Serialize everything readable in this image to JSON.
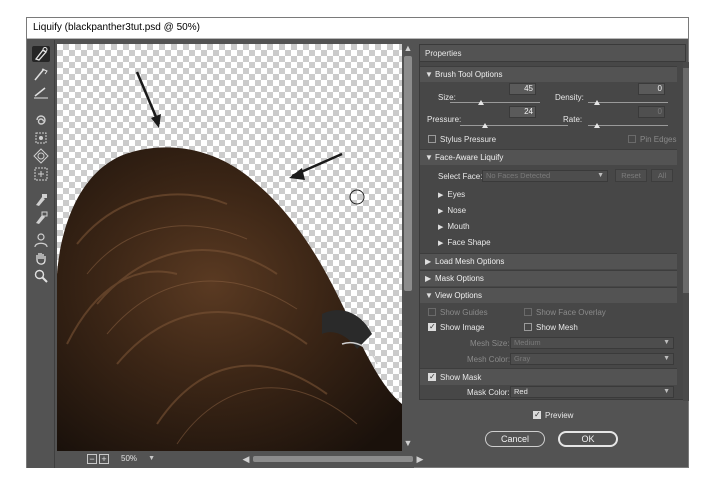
{
  "window": {
    "title": "Liquify (blackpanther3tut.psd @ 50%)"
  },
  "toolbar": {
    "tools": [
      {
        "name": "forward-warp-tool-icon",
        "active": true
      },
      {
        "name": "reconstruct-tool-icon"
      },
      {
        "name": "smooth-tool-icon"
      },
      {
        "name": "twirl-clockwise-tool-icon"
      },
      {
        "name": "pucker-tool-icon"
      },
      {
        "name": "bloat-tool-icon"
      },
      {
        "name": "push-left-tool-icon"
      },
      {
        "name": "freeze-mask-tool-icon"
      },
      {
        "name": "thaw-mask-tool-icon"
      },
      {
        "name": "face-tool-icon"
      },
      {
        "name": "hand-tool-icon"
      },
      {
        "name": "zoom-tool-icon"
      }
    ]
  },
  "status": {
    "zoom_minus": "−",
    "zoom_plus": "+",
    "zoom": "50%"
  },
  "properties": {
    "title": "Properties",
    "brush": {
      "title": "Brush Tool Options",
      "size_label": "Size:",
      "size": "45",
      "size_level": 0.45,
      "density_label": "Density:",
      "density": "0",
      "density_level": 0.0,
      "pressure_label": "Pressure:",
      "pressure": "24",
      "pressure_level": 0.24,
      "rate_label": "Rate:",
      "rate": "0",
      "rate_level": 0.0,
      "stylus_label": "Stylus Pressure",
      "pin_label": "Pin Edges"
    },
    "face": {
      "title": "Face-Aware Liquify",
      "select_label": "Select Face:",
      "select_value": "No Faces Detected",
      "reset": "Reset",
      "all": "All",
      "items": [
        "Eyes",
        "Nose",
        "Mouth",
        "Face Shape"
      ]
    },
    "load_mesh": {
      "title": "Load Mesh Options"
    },
    "mask": {
      "title": "Mask Options"
    },
    "view": {
      "title": "View Options",
      "show_guides": "Show Guides",
      "show_face_overlay": "Show Face Overlay",
      "show_image": "Show Image",
      "show_mesh": "Show Mesh",
      "mesh_size_label": "Mesh Size:",
      "mesh_size": "Medium",
      "mesh_color_label": "Mesh Color:",
      "mesh_color": "Gray",
      "show_mask": "Show Mask",
      "mask_color_label": "Mask Color:",
      "mask_color": "Red"
    }
  },
  "footer": {
    "preview": "Preview",
    "cancel": "Cancel",
    "ok": "OK"
  }
}
